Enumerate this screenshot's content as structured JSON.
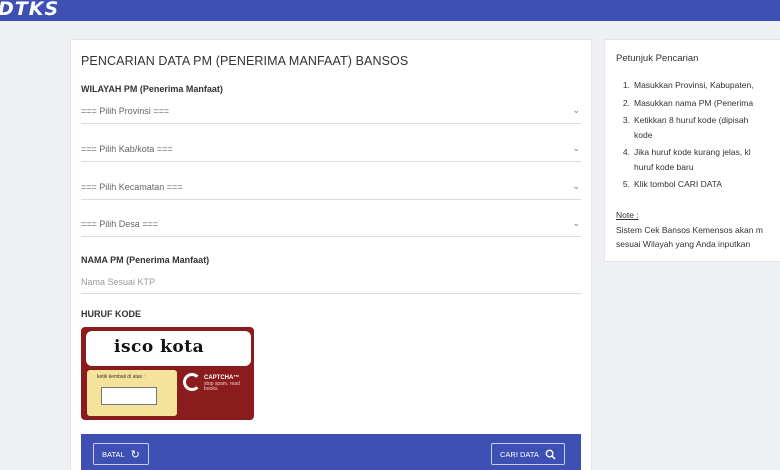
{
  "header": {
    "logo": "DTKS"
  },
  "form": {
    "title": "PENCARIAN DATA PM (PENERIMA MANFAAT) BANSOS",
    "wilayah_label": "WILAYAH PM (Penerima Manfaat)",
    "selects": [
      {
        "placeholder": "=== Pilih Provinsi ==="
      },
      {
        "placeholder": "=== Pilih Kab/kota ==="
      },
      {
        "placeholder": "=== Pilih Kecamatan ==="
      },
      {
        "placeholder": "=== Pilih Desa ==="
      }
    ],
    "nama_label": "NAMA PM (Penerima Manfaat)",
    "nama_placeholder": "Nama Sesuai KTP",
    "kode_label": "HURUF KODE",
    "captcha": {
      "words": "isco kota",
      "input_label": "ketik kembali di atas :",
      "brand": "CAPTCHA™",
      "brand_sub": "stop spam. read books."
    },
    "buttons": {
      "cancel": "BATAL",
      "search": "CARI DATA"
    }
  },
  "sidebar": {
    "title": "Petunjuk Pencarian",
    "steps": [
      {
        "n": "1.",
        "lines": [
          "Masukkan Provinsi, Kabupaten,"
        ]
      },
      {
        "n": "2.",
        "lines": [
          "Masukkan nama PM (Penerima"
        ]
      },
      {
        "n": "3.",
        "lines": [
          "Ketikkan 8 huruf kode (dipisah",
          "kode"
        ]
      },
      {
        "n": "4.",
        "lines": [
          "Jika huruf kode kurang jelas, kl",
          "huruf kode baru"
        ]
      },
      {
        "n": "5.",
        "lines": [
          "Klik tombol CARI DATA"
        ]
      }
    ],
    "note_title": "Note :",
    "note_lines": [
      "Sistem Cek Bansos Kemensos akan m",
      "sesuai Wilayah yang Anda inputkan"
    ]
  },
  "icons": {
    "chevron": "chevron-down-icon",
    "refresh": "refresh-icon",
    "search": "search-icon"
  },
  "colors": {
    "brand_blue": "#3e50b4",
    "captcha_red": "#8b1c1e",
    "captcha_yellow": "#f6e39b"
  }
}
